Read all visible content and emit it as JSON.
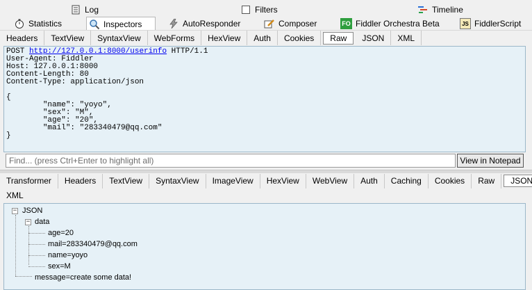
{
  "top_tabs_row1": [
    {
      "label": "Log",
      "icon": "log-icon"
    },
    {
      "label": "Filters",
      "icon": "checkbox-icon"
    },
    {
      "label": "Timeline",
      "icon": "timeline-icon"
    }
  ],
  "top_tabs_row2": [
    {
      "label": "Statistics",
      "icon": "stopwatch-icon"
    },
    {
      "label": "Inspectors",
      "icon": "magnifier-icon"
    },
    {
      "label": "AutoResponder",
      "icon": "lightning-icon"
    },
    {
      "label": "Composer",
      "icon": "pencil-icon"
    },
    {
      "label": "Fiddler Orchestra Beta",
      "icon": "fo-icon",
      "badge": "FO"
    },
    {
      "label": "FiddlerScript",
      "icon": "js-icon",
      "badge": "JS"
    }
  ],
  "request_tabs": [
    "Headers",
    "TextView",
    "SyntaxView",
    "WebForms",
    "HexView",
    "Auth",
    "Cookies",
    "Raw",
    "JSON",
    "XML"
  ],
  "request_active_tab": "Raw",
  "request": {
    "method": "POST",
    "url": "http://127.0.0.1:8000/userinfo",
    "protocol": "HTTP/1.1",
    "lines": [
      "User-Agent: Fiddler",
      "Host: 127.0.0.1:8000",
      "Content-Length: 80",
      "Content-Type: application/json",
      "",
      "{"
    ],
    "body_lines": [
      "\"name\": \"yoyo\",",
      "\"sex\": \"M\",",
      "\"age\": \"20\",",
      "\"mail\": \"283340479@qq.com\""
    ],
    "close": "}"
  },
  "find": {
    "placeholder": "Find... (press Ctrl+Enter to highlight all)",
    "button": "View in Notepad"
  },
  "response_tabs": [
    "Transformer",
    "Headers",
    "TextView",
    "SyntaxView",
    "ImageView",
    "HexView",
    "WebView",
    "Auth",
    "Caching",
    "Cookies",
    "Raw",
    "JSON"
  ],
  "response_tabs_row2": [
    "XML"
  ],
  "response_active_tab": "JSON",
  "tree": {
    "root": "JSON",
    "data_label": "data",
    "data_children": [
      "age=20",
      "mail=283340479@qq.com",
      "name=yoyo",
      "sex=M"
    ],
    "message": "message=create some data!",
    "expander_symbol": "−"
  },
  "colors": {
    "panel_bg": "#e6f1f7",
    "link": "#0000ee",
    "fo_badge": "#2e9e3e"
  }
}
